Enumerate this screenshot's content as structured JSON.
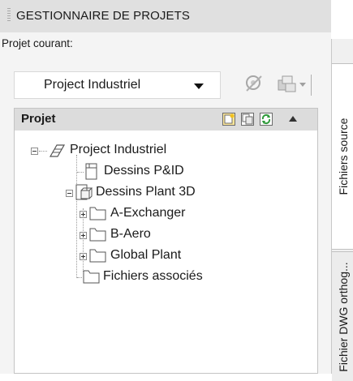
{
  "palette": {
    "title": "GESTIONNAIRE DE PROJETS",
    "current_project_label": "Projet courant:",
    "current_project_value": "Project Industriel"
  },
  "toolbar": {
    "icons": [
      "project-settings-icon",
      "publish-icon"
    ]
  },
  "tree": {
    "header_title": "Projet",
    "header_icons": [
      "new-drawing-icon",
      "copy-drawing-icon",
      "refresh-icon",
      "collapse-icon"
    ],
    "root": "Project Industriel",
    "items": [
      {
        "label": "Dessins P&ID",
        "icon": "pid-drawings-icon"
      },
      {
        "label": "Dessins Plant 3D",
        "icon": "plant3d-drawings-icon"
      },
      {
        "label": "A-Exchanger",
        "icon": "folder-icon"
      },
      {
        "label": "B-Aero",
        "icon": "folder-icon"
      },
      {
        "label": "Global Plant",
        "icon": "folder-icon"
      },
      {
        "label": "Fichiers associés",
        "icon": "folder-icon"
      }
    ]
  },
  "side_tabs": [
    "Fichiers source",
    "Fichier DWG orthog..."
  ],
  "colors": {
    "refresh_green": "#2f9a3a",
    "folder_yellow": "#f2d46a",
    "panel_bg": "#f4f4f4"
  }
}
